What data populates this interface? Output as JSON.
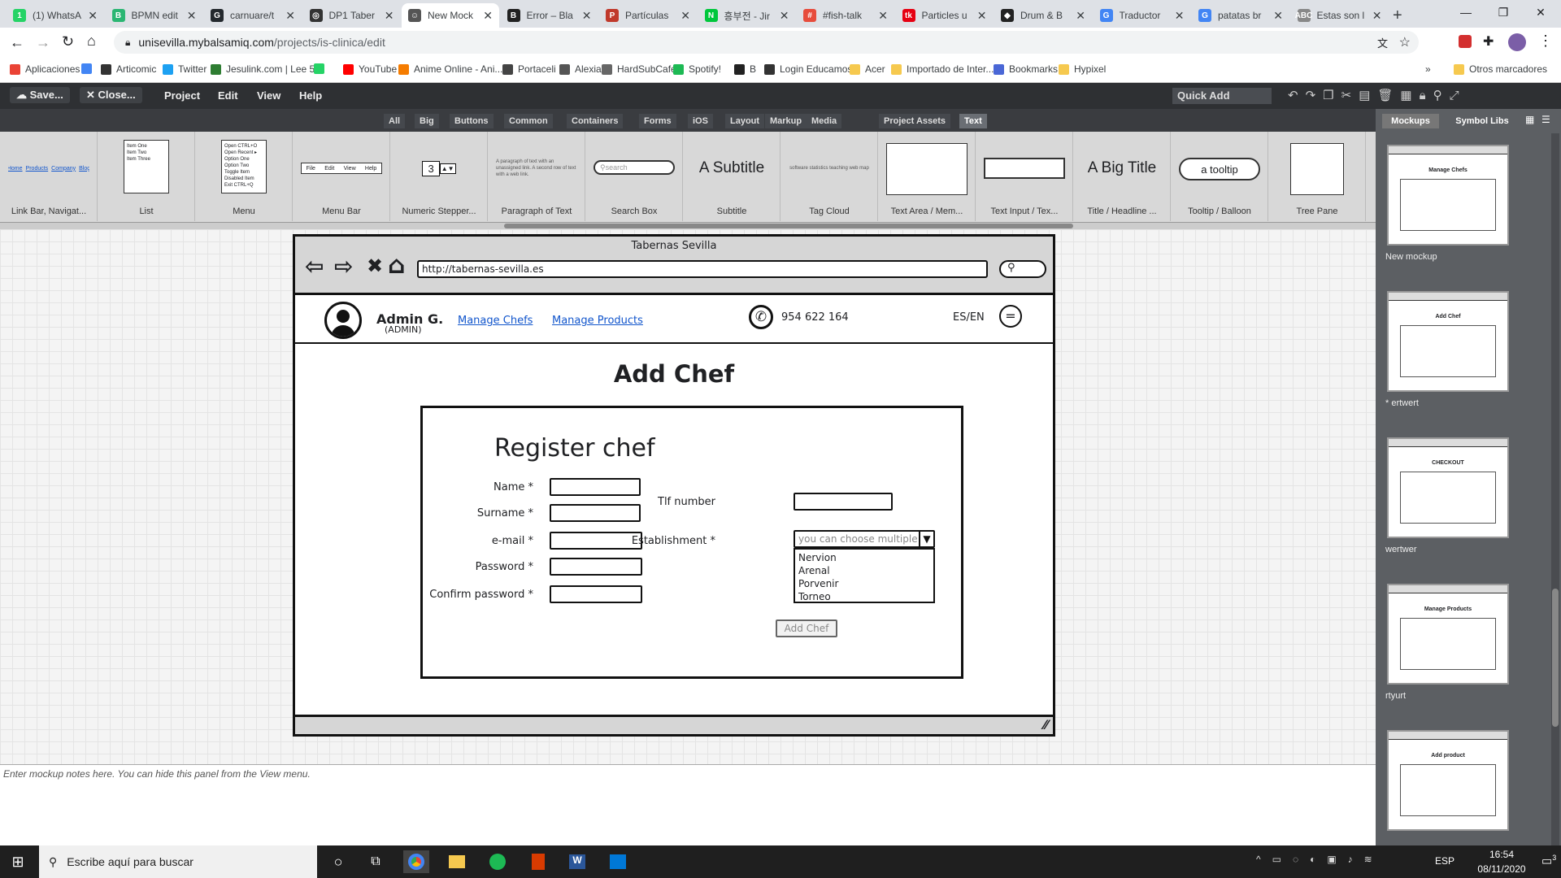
{
  "browser": {
    "tabs": [
      {
        "title": "(1) WhatsA",
        "color": "#25d366",
        "icon": "1"
      },
      {
        "title": "BPMN edit",
        "color": "#2bb673",
        "icon": "B"
      },
      {
        "title": "carnuare/t",
        "color": "#24292e",
        "icon": "G"
      },
      {
        "title": "DP1 Taber",
        "color": "#333",
        "icon": "◎"
      },
      {
        "title": "New Mock",
        "color": "#555",
        "icon": "☺"
      },
      {
        "title": "Error – Bla",
        "color": "#222",
        "icon": "B"
      },
      {
        "title": "Partículas",
        "color": "#c0392b",
        "icon": "P"
      },
      {
        "title": "흥부전 - Jir",
        "color": "#00c73c",
        "icon": "N"
      },
      {
        "title": "#fish-talk",
        "color": "#e74c3c",
        "icon": "#"
      },
      {
        "title": "Particles u",
        "color": "#e60012",
        "icon": "tk"
      },
      {
        "title": "Drum & B",
        "color": "#222",
        "icon": "◆"
      },
      {
        "title": "Traductor",
        "color": "#4285f4",
        "icon": "G"
      },
      {
        "title": "patatas br",
        "color": "#4285f4",
        "icon": "G"
      },
      {
        "title": "Estas son l",
        "color": "#888",
        "icon": "ABC"
      }
    ],
    "url_host": "unisevilla.mybalsamiq.com",
    "url_path": "/projects/is-clinica/edit",
    "bookmarks": [
      {
        "label": "Aplicaciones",
        "color": "#ea4335"
      },
      {
        "label": "",
        "color": "#4285f4"
      },
      {
        "label": "Articomic",
        "color": "#333"
      },
      {
        "label": "Twitter",
        "color": "#1da1f2"
      },
      {
        "label": "Jesulink.com | Lee 5...",
        "color": "#2e7d32"
      },
      {
        "label": "",
        "color": "#25d366"
      },
      {
        "label": "YouTube",
        "color": "#ff0000"
      },
      {
        "label": "Anime Online - Ani...",
        "color": "#f57c00"
      },
      {
        "label": "Portaceli",
        "color": "#444"
      },
      {
        "label": "Alexia",
        "color": "#555"
      },
      {
        "label": "HardSubCafe",
        "color": "#666"
      },
      {
        "label": "Spotify!",
        "color": "#1db954"
      },
      {
        "label": "B",
        "color": "#222"
      },
      {
        "label": "Login Educamos",
        "color": "#333"
      },
      {
        "label": "Acer",
        "color": "#f6c94f"
      },
      {
        "label": "Importado de Inter...",
        "color": "#f6c94f"
      },
      {
        "label": "Bookmarks",
        "color": "#4a67d6"
      },
      {
        "label": "Hypixel",
        "color": "#f6c94f"
      }
    ],
    "other_bookmarks": "Otros marcadores",
    "more_bookmarks": "»"
  },
  "toolbar": {
    "save": "Save...",
    "close": "Close...",
    "menu": [
      "Project",
      "Edit",
      "View",
      "Help"
    ],
    "quick_add": "Quick Add"
  },
  "library_tabs": [
    "All",
    "Big",
    "Buttons",
    "Common",
    "Containers",
    "Forms",
    "iOS",
    "Layout",
    "Markup",
    "Media",
    "Project Assets",
    "Text"
  ],
  "library_selected": "Text",
  "library_items": [
    {
      "label": "Link Bar, Navigat...",
      "links": [
        "Home",
        "Products",
        "Company",
        "Blog"
      ]
    },
    {
      "label": "List",
      "items": [
        "Item One",
        "Item Two",
        "Item Three"
      ]
    },
    {
      "label": "Menu",
      "items": [
        "Open    CTRL+O",
        "Open Recent  ▸",
        "Option One",
        "Option Two",
        "Toggle Item",
        "Disabled Item",
        "Exit    CTRL+Q"
      ]
    },
    {
      "label": "Menu Bar",
      "items": [
        "File",
        "Edit",
        "View",
        "Help"
      ]
    },
    {
      "label": "Numeric Stepper...",
      "value": "3"
    },
    {
      "label": "Paragraph of Text",
      "text": "A paragraph of text with an unassigned link. A second row of text with a web link."
    },
    {
      "label": "Search Box",
      "placeholder": "search"
    },
    {
      "label": "Subtitle",
      "text": "A Subtitle"
    },
    {
      "label": "Tag Cloud",
      "text": "software statistics teaching web map"
    },
    {
      "label": "Text Area / Mem...",
      "text": ""
    },
    {
      "label": "Text Input / Tex...",
      "text": ""
    },
    {
      "label": "Title / Headline ...",
      "text": "A Big Title"
    },
    {
      "label": "Tooltip / Balloon",
      "text": "a tooltip"
    },
    {
      "label": "Tree Pane",
      "text": ""
    }
  ],
  "right_panel": {
    "tabs": [
      "Mockups",
      "Symbol Libs"
    ],
    "mockups": [
      {
        "name": "New mockup",
        "title": "Manage Chefs"
      },
      {
        "name": "* ertwert",
        "title": "Add Chef"
      },
      {
        "name": "wertwer",
        "title": "CHECKOUT"
      },
      {
        "name": "rtyurt",
        "title": "Manage Products"
      },
      {
        "name": "",
        "title": "Add product"
      }
    ]
  },
  "mockup": {
    "window_title": "Tabernas Sevilla",
    "url": "http://tabernas-sevilla.es",
    "user_name": "Admin G.",
    "user_role": "(ADMIN)",
    "nav_links": [
      "Manage Chefs",
      "Manage Products"
    ],
    "phone": "954 622 164",
    "lang": "ES/EN",
    "menu_glyph": "=",
    "page_title": "Add Chef",
    "form_title": "Register chef",
    "fields": [
      {
        "label": "Name *"
      },
      {
        "label": "Surname *"
      },
      {
        "label": "e-mail *"
      },
      {
        "label": "Password *"
      },
      {
        "label": "Confirm password *"
      }
    ],
    "tlf_label": "Tlf number",
    "establishment_label": "Establishment *",
    "establishment_placeholder": "you can choose multiple",
    "establishment_options": [
      "Nervion",
      "Arenal",
      "Porvenir",
      "Torneo"
    ],
    "submit": "Add Chef"
  },
  "notes_placeholder": "Enter mockup notes here. You can hide this panel from the View menu.",
  "taskbar": {
    "search": "Escribe aquí para buscar",
    "lang": "ESP",
    "time": "16:54",
    "date": "08/11/2020",
    "notifications": "3"
  }
}
